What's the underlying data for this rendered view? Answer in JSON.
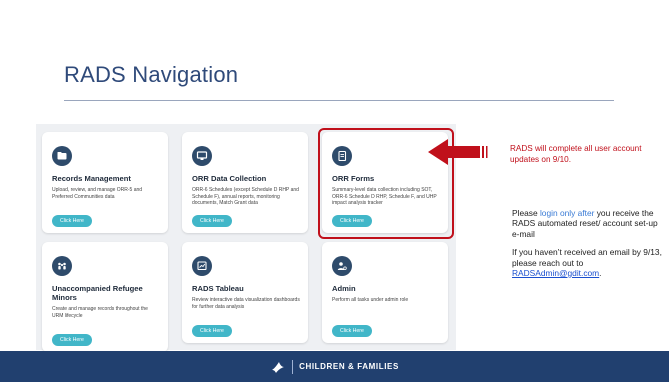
{
  "slide": {
    "title": "RADS Navigation"
  },
  "cards": [
    {
      "title": "Records Management",
      "description": "Upload, review, and manage ORR-5 and Preferred Communities data",
      "button": "Click Here",
      "icon": "folder-icon"
    },
    {
      "title": "ORR Data Collection",
      "description": "ORR-6 Schedules (except Schedule D RHP and Schedule F), annual reports, monitoring documents, Match Grant data",
      "button": "Click Here",
      "icon": "monitor-icon"
    },
    {
      "title": "ORR Forms",
      "description": "Summary-level data collection including SOT, ORR-6 Schedule D RHP, Schedule F, and UHP impact analysis tracker",
      "button": "Click Here",
      "icon": "document-icon"
    },
    {
      "title": "Unaccompanied Refugee Minors",
      "description": "Create and manage records throughout the URM lifecycle",
      "button": "Click Here",
      "icon": "people-icon"
    },
    {
      "title": "RADS Tableau",
      "description": "Review interactive data visualization dashboards for further data analysis",
      "button": "Click Here",
      "icon": "chart-icon"
    },
    {
      "title": "Admin",
      "description": "Perform all tasks under admin role",
      "button": "Click Here",
      "icon": "admin-icon"
    }
  ],
  "callout": {
    "text": "RADS will complete all user account updates on 9/10."
  },
  "info": {
    "p1_before": "Please ",
    "p1_highlight": "login only after",
    "p1_after": " you receive the RADS automated reset/ account set-up e-mail",
    "p2_text": "If you haven’t received an email by 9/13, please reach out to ",
    "p2_link": "RADSAdmin@gdit.com",
    "p2_end": "."
  },
  "footer": {
    "brand": "CHILDREN & FAMILIES"
  },
  "colors": {
    "title": "#2f4a7a",
    "accent_red": "#c0101b",
    "footer_bg": "#21406f",
    "button": "#41b6c8"
  }
}
